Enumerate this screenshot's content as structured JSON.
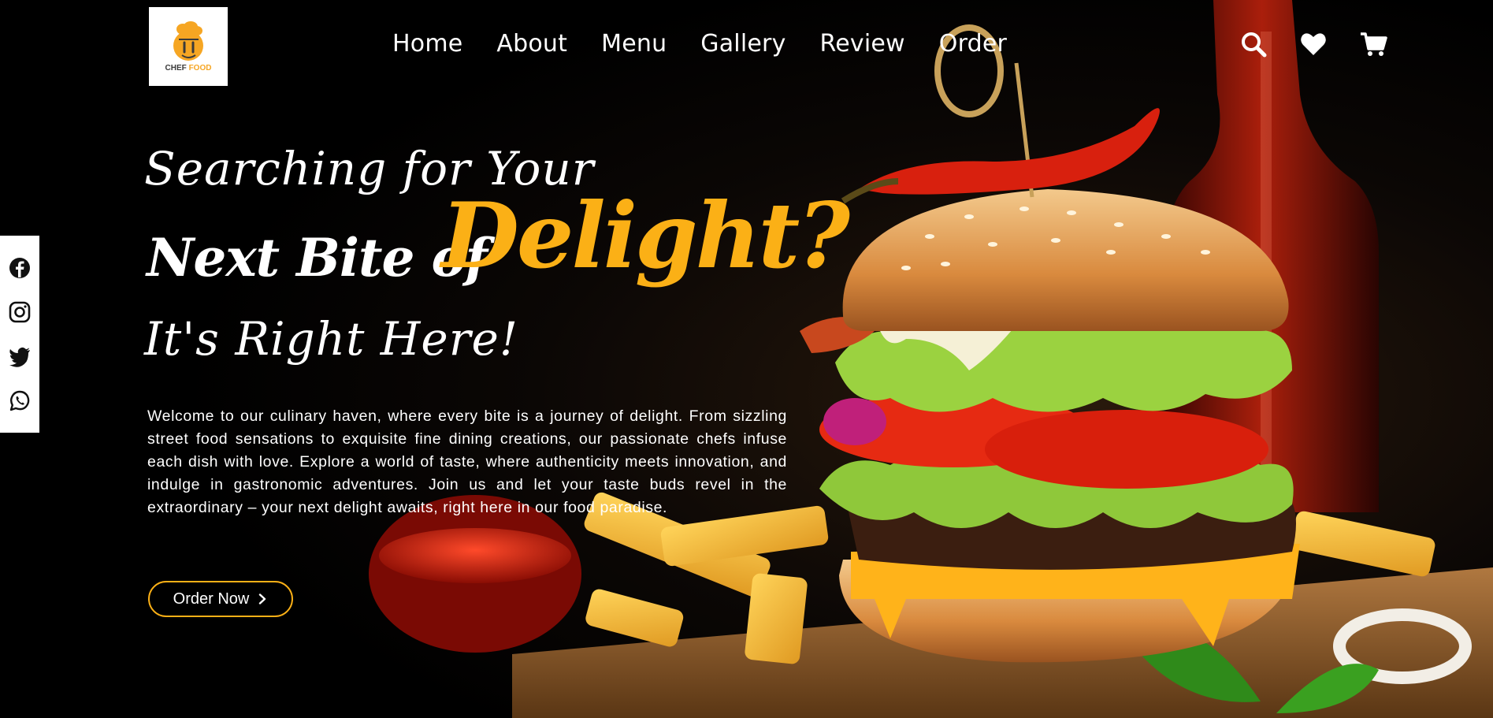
{
  "brand": {
    "logo_text_dark": "CHEF",
    "logo_text_accent": "FOOD",
    "logo_icon": "chef-hat-face-icon"
  },
  "nav": {
    "items": [
      "Home",
      "About",
      "Menu",
      "Gallery",
      "Review",
      "Order"
    ]
  },
  "header_icons": [
    "search-icon",
    "heart-icon",
    "cart-icon"
  ],
  "social_icons": [
    "facebook-icon",
    "instagram-icon",
    "twitter-icon",
    "whatsapp-icon"
  ],
  "hero": {
    "line1": "Searching for Your",
    "line2": "Next Bite of",
    "line2_accent": "Delight?",
    "line3": "It's Right Here!",
    "intro": "Welcome to our culinary haven, where every bite is a journey of delight. From sizzling street food sensations to exquisite fine dining creations, our passionate chefs infuse each dish with love. Explore a world of taste, where authenticity meets innovation, and indulge in gastronomic adventures. Join us and let your taste buds revel in the extraordinary – your next delight awaits, right here in our food paradise.",
    "cta_label": "Order Now",
    "cta_icon": "chevron-right-icon"
  },
  "colors": {
    "accent": "#fbb016",
    "background": "#000000",
    "text": "#ffffff"
  }
}
